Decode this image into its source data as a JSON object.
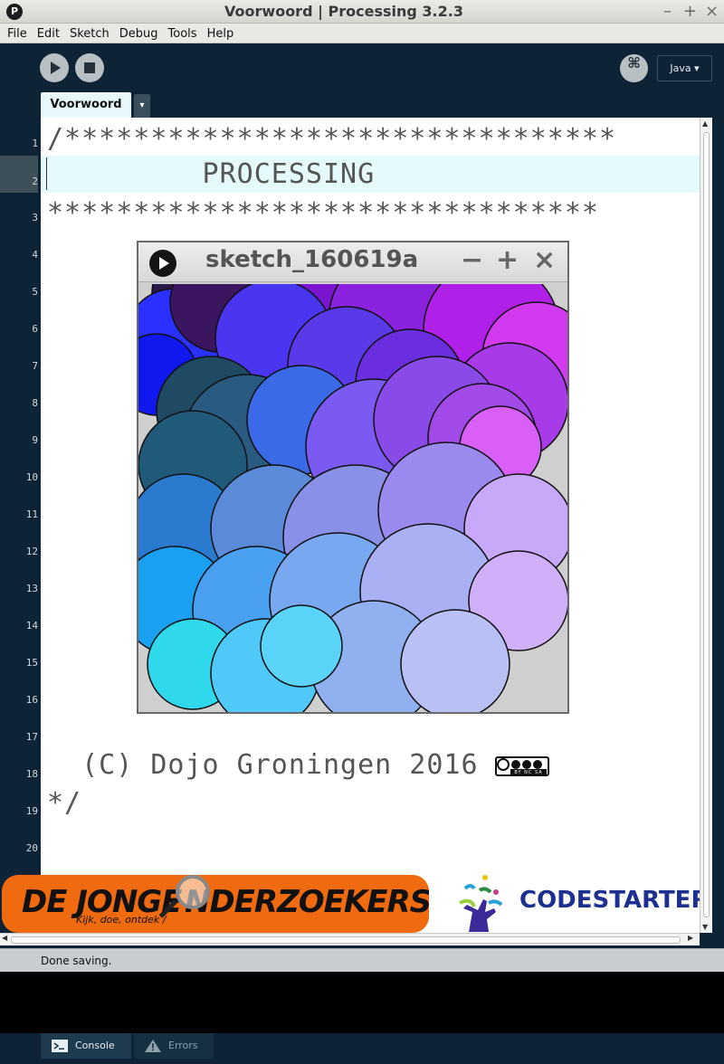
{
  "window": {
    "title": "Voorwoord | Processing 3.2.3",
    "app_icon": "P",
    "minimize": "–",
    "maximize": "+",
    "close": "×"
  },
  "menu": [
    "File",
    "Edit",
    "Sketch",
    "Debug",
    "Tools",
    "Help"
  ],
  "toolbar": {
    "run": "run-icon",
    "stop": "stop-icon",
    "debug_glyph": "⌘",
    "mode": "Java ▾"
  },
  "tab": {
    "label": "Voorwoord",
    "menu": "▾"
  },
  "line_numbers": [
    "1",
    "2",
    "3",
    "4",
    "5",
    "6",
    "7",
    "8",
    "9",
    "10",
    "11",
    "12",
    "13",
    "14",
    "15",
    "16",
    "17",
    "18",
    "19",
    "20"
  ],
  "code": {
    "line1": "/********************************",
    "line2": "         PROCESSING",
    "line3": "********************************",
    "line18": "  (C) Dojo Groningen 2016",
    "line19": "*/"
  },
  "sketch": {
    "title": "sketch_160619a",
    "minimize": "−",
    "maximize": "+",
    "close": "×",
    "cc_label": "BY NC SA"
  },
  "logos": {
    "left_a": "DE JONGE",
    "left_b": "NDERZOEKERS",
    "left_tagline": "Kijk, doe, ontdek /",
    "right": "CODESTARTER"
  },
  "status": "Done saving.",
  "console_tabs": [
    {
      "label": "Console"
    },
    {
      "label": "Errors"
    }
  ],
  "colors": {
    "background": "#0e2436",
    "editor": "#ffffff",
    "current_line": "#e4fafb",
    "logo_orange": "#f06a10",
    "codestarter_blue": "#1d2f8f"
  }
}
